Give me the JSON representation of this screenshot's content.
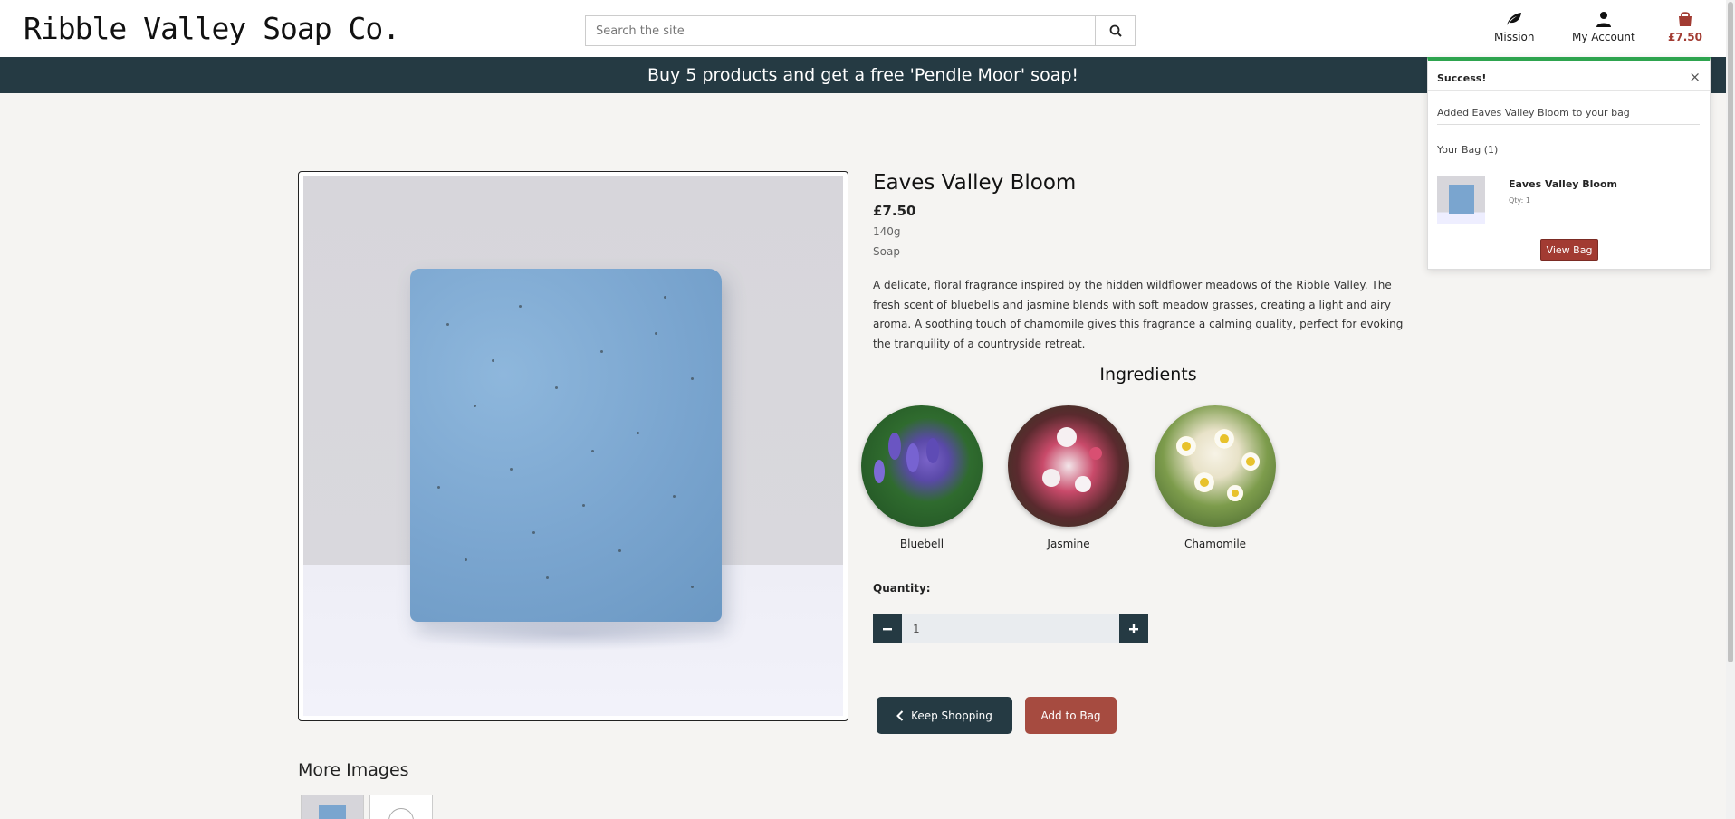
{
  "header": {
    "logo": "Ribble Valley Soap Co.",
    "search_placeholder": "Search the site",
    "nav": {
      "mission": "Mission",
      "account": "My Account",
      "bag_total": "£7.50"
    }
  },
  "banner": "Buy 5 products and get a free 'Pendle Moor' soap!",
  "product": {
    "name": "Eaves Valley Bloom",
    "price": "£7.50",
    "weight": "140g",
    "category": "Soap",
    "description": "A delicate, floral fragrance inspired by the hidden wildflower meadows of the Ribble Valley. The fresh scent of bluebells and jasmine blends with soft meadow grasses, creating a light and airy aroma. A soothing touch of chamomile gives this fragrance a calming quality, perfect for evoking the tranquility of a countryside retreat.",
    "ingredients_title": "Ingredients",
    "ingredients": [
      "Bluebell",
      "Jasmine",
      "Chamomile"
    ],
    "quantity_label": "Quantity:",
    "quantity_value": "1",
    "keep_shopping": "Keep Shopping",
    "add_to_bag": "Add to Bag"
  },
  "more_images_title": "More Images",
  "toast": {
    "title": "Success!",
    "close": "×",
    "message": "Added Eaves Valley Bloom to your bag",
    "bag_heading": "Your Bag (1)",
    "item_name": "Eaves Valley Bloom",
    "item_qty": "Qty: 1",
    "view_bag": "View Bag"
  },
  "colors": {
    "banner": "#253a43",
    "accent": "#a64b40",
    "success": "#2ea44f"
  },
  "icons": {
    "mission": "leaf-icon",
    "account": "user-icon",
    "bag": "shopping-bag-icon",
    "search": "search-icon",
    "back": "chevron-left-icon"
  }
}
